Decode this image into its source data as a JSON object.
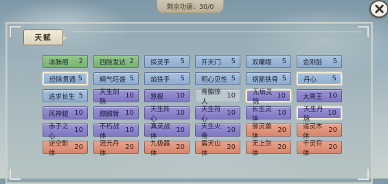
{
  "currency": {
    "label": "剩余功德：30/0"
  },
  "panel": {
    "tab_label": "天赋"
  },
  "colors": {
    "green": "#78b36f",
    "blue": "#8eacd0",
    "purple": "#7f78c2",
    "orange": "#d8856b"
  },
  "talents": [
    {
      "name": "冰肺阁",
      "level": "2",
      "color": "green"
    },
    {
      "name": "四肢发达",
      "level": "2",
      "color": "green"
    },
    {
      "name": "探灵手",
      "level": "5",
      "color": "blue"
    },
    {
      "name": "开天门",
      "level": "5",
      "color": "blue"
    },
    {
      "name": "双瞳眼",
      "level": "5",
      "color": "blue"
    },
    {
      "name": "金刚脏",
      "level": "5",
      "color": "blue"
    },
    {
      "name": "经脉贯通",
      "level": "5",
      "color": "blue",
      "selected": true
    },
    {
      "name": "精气旺盛",
      "level": "5",
      "color": "blue"
    },
    {
      "name": "焰铁手",
      "level": "5",
      "color": "blue"
    },
    {
      "name": "明心见性",
      "level": "5",
      "color": "blue"
    },
    {
      "name": "钢筋铁骨",
      "level": "5",
      "color": "blue"
    },
    {
      "name": "丹心",
      "level": "5",
      "color": "blue",
      "selected": true
    },
    {
      "name": "追求长生",
      "level": "5",
      "color": "blue"
    },
    {
      "name": "天生剑脉",
      "level": "10",
      "color": "purple"
    },
    {
      "name": "慧根",
      "level": "10",
      "color": "purple"
    },
    {
      "name": "骨骼惊人",
      "level": "10",
      "color": "ghost"
    },
    {
      "name": "无垢灵脉",
      "level": "10",
      "color": "purple",
      "selected": true
    },
    {
      "name": "大胃王",
      "level": "10",
      "color": "purple"
    },
    {
      "name": "风神腿",
      "level": "10",
      "color": "purple"
    },
    {
      "name": "麒麟臂",
      "level": "10",
      "color": "purple"
    },
    {
      "name": "天生阵心",
      "level": "10",
      "color": "purple"
    },
    {
      "name": "天生符心",
      "level": "10",
      "color": "purple"
    },
    {
      "name": "长生灵体",
      "level": "10",
      "color": "purple"
    },
    {
      "name": "天生丹脉",
      "level": "10",
      "color": "purple",
      "selected": true
    },
    {
      "name": "赤子之心",
      "level": "10",
      "color": "purple"
    },
    {
      "name": "不朽战体",
      "level": "10",
      "color": "purple"
    },
    {
      "name": "真灵战体",
      "level": "10",
      "color": "purple"
    },
    {
      "name": "天生火骨",
      "level": "10",
      "color": "purple"
    },
    {
      "name": "御灵兽体",
      "level": "20",
      "color": "orange"
    },
    {
      "name": "道灵木体",
      "level": "20",
      "color": "orange"
    },
    {
      "name": "逆空影体",
      "level": "20",
      "color": "orange"
    },
    {
      "name": "混元丹体",
      "level": "20",
      "color": "orange"
    },
    {
      "name": "九极器体",
      "level": "20",
      "color": "orange"
    },
    {
      "name": "震天山体",
      "level": "20",
      "color": "orange"
    },
    {
      "name": "无上剑体",
      "level": "20",
      "color": "orange"
    },
    {
      "name": "千灵符体",
      "level": "20",
      "color": "orange"
    }
  ]
}
